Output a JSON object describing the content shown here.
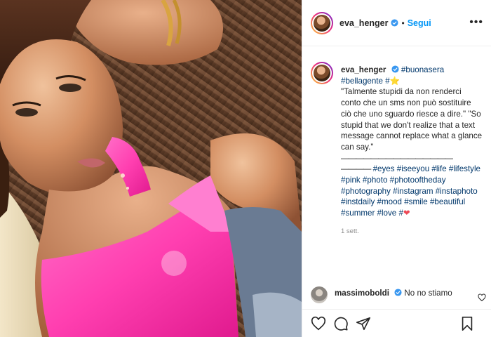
{
  "post": {
    "username": "eva_henger",
    "follow_label": "Segui",
    "more_label": "•••",
    "photo_icon": "photo-image"
  },
  "caption": {
    "username": "eva_henger",
    "text_1": "#buonasera",
    "text_2": "#bellagente #",
    "text_2_emoji": "⭐",
    "quote_it": "\"Talmente stupidi da non renderci conto che un sms non può sostituire ciò che uno sguardo riesce a dire.\"",
    "quote_en": " \"So stupid that we don't realize that a text message cannot replace what a glance can say.\"",
    "divider": "———————————————",
    "dash_prefix": "————",
    "hashtags_1": " #eyes #iseeyou #life #lifestyle #pink #photo #photooftheday #photography #instagram #instaphoto #instdaily #mood #smile #beautiful #summer #love #",
    "heart_emoji": "❤",
    "time": "1 sett."
  },
  "comment": {
    "username": "massimoboldi",
    "text": "No no stiamo"
  },
  "icons": {
    "like": "heart-icon",
    "comment": "comment-icon",
    "share": "paper-plane-icon",
    "save": "bookmark-icon"
  },
  "colors": {
    "link": "#0095f6",
    "hashtag": "#00376b",
    "verified": "#3897f0",
    "heart": "#ed4956"
  }
}
